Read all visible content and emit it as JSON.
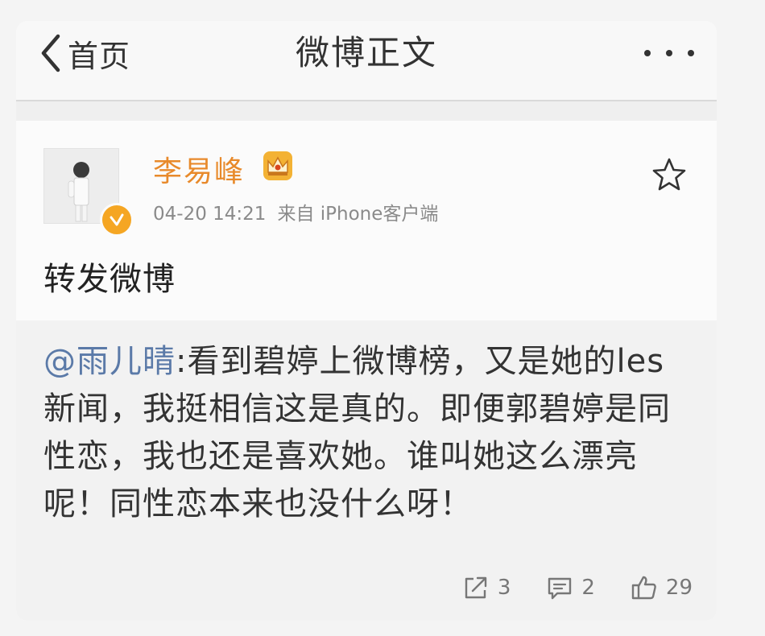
{
  "navbar": {
    "back_label": "首页",
    "title": "微博正文"
  },
  "post": {
    "author": "李易峰",
    "time": "04-20 14:21",
    "source": "来自 iPhone客户端",
    "text": "转发微博"
  },
  "repost": {
    "mention": "@雨儿晴",
    "text": ":看到碧婷上微博榜，又是她的les新闻，我挺相信这是真的。即便郭碧婷是同性恋，我也还是喜欢她。谁叫她这么漂亮呢！同性恋本来也没什么呀！",
    "actions": {
      "share_count": "3",
      "comment_count": "2",
      "like_count": "29"
    }
  },
  "colors": {
    "author_name": "#e88a2b",
    "mention": "#5b7aa8",
    "verified_badge": "#f5a623"
  },
  "icons": [
    "chevron-left-icon",
    "more-icon",
    "crown-icon",
    "verified-icon",
    "star-icon",
    "share-icon",
    "comment-icon",
    "thumbs-up-icon"
  ]
}
